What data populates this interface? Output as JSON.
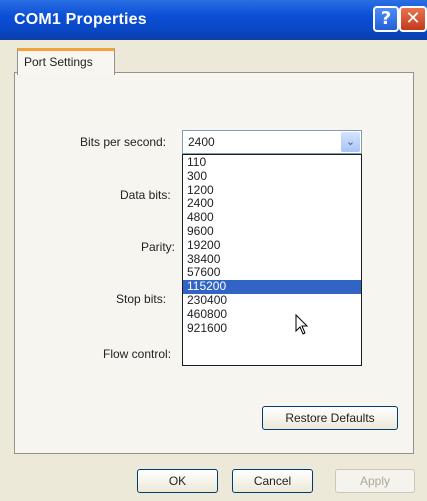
{
  "window": {
    "title": "COM1 Properties",
    "help_glyph": "?",
    "close_glyph": "✕"
  },
  "tabs": [
    {
      "label": "Port Settings"
    }
  ],
  "fields": {
    "bits_per_second": {
      "label": "Bits per second:",
      "value": "2400"
    },
    "data_bits": {
      "label": "Data bits:"
    },
    "parity": {
      "label": "Parity:"
    },
    "stop_bits": {
      "label": "Stop bits:"
    },
    "flow_control": {
      "label": "Flow control:"
    }
  },
  "dropdown": {
    "arrow_glyph": "⌄",
    "options": [
      "110",
      "300",
      "1200",
      "2400",
      "4800",
      "9600",
      "19200",
      "38400",
      "57600",
      "115200",
      "230400",
      "460800",
      "921600"
    ],
    "highlighted": "115200"
  },
  "buttons": {
    "restore_defaults": "Restore Defaults",
    "ok": "OK",
    "cancel": "Cancel",
    "apply": "Apply"
  },
  "colors": {
    "title_bar": "#0a4fd7",
    "selection": "#3164c5",
    "tab_accent": "#f4a33a"
  }
}
